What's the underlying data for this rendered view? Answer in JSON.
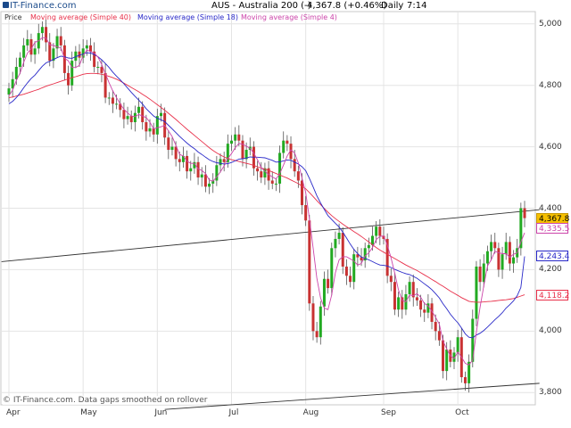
{
  "header": {
    "brand": "IT-Finance.com",
    "title": "AUS - Australia 200 (-)",
    "quote": "4,367.8 (+0.46%)",
    "interval": "Daily",
    "time": "7:14"
  },
  "legend": [
    {
      "label": "Price",
      "color": "#333333"
    },
    {
      "label": "Moving average (Simple 40)",
      "color": "#e8304a"
    },
    {
      "label": "Moving average (Simple 18)",
      "color": "#2828c8"
    },
    {
      "label": "Moving average (Simple 4)",
      "color": "#cc44aa"
    }
  ],
  "footer": "© IT-Finance.com. Data gaps smoothed on rollover",
  "badges": [
    {
      "text": "4,367.8",
      "value": 4367.8,
      "bg": "#f5c000",
      "fg": "#000000",
      "border": "#c89800"
    },
    {
      "text": "4,335.5",
      "value": 4335.5,
      "bg": "#ffffff",
      "fg": "#cc44aa",
      "border": "#cc44aa"
    },
    {
      "text": "4,243.4",
      "value": 4243.4,
      "bg": "#ffffff",
      "fg": "#2828c8",
      "border": "#2828c8"
    },
    {
      "text": "4,118.2",
      "value": 4118.2,
      "bg": "#ffffff",
      "fg": "#e8304a",
      "border": "#e8304a"
    }
  ],
  "colors": {
    "up": "#22aa22",
    "down": "#c83232",
    "wick": "#555555",
    "grid": "#e4e4e4",
    "trend": "#333333"
  },
  "chart_data": {
    "type": "candlestick",
    "title": "AUS - Australia 200 (-)",
    "ylim": [
      3760,
      5040
    ],
    "yticks": [
      3800,
      4000,
      4200,
      4400,
      4600,
      4800,
      5000
    ],
    "ytick_labels": [
      "3,800",
      "4,000",
      "4,200",
      "4,400",
      "4,600",
      "4,800",
      "5,000"
    ],
    "month_ticks": [
      {
        "label": "Apr",
        "day": 0
      },
      {
        "label": "May",
        "day": 20
      },
      {
        "label": "Jun",
        "day": 40
      },
      {
        "label": "Jul",
        "day": 60
      },
      {
        "label": "Aug",
        "day": 80
      },
      {
        "label": "Sep",
        "day": 101
      },
      {
        "label": "Oct",
        "day": 121
      }
    ],
    "n_days": 140,
    "closes": [
      4790,
      4820,
      4860,
      4890,
      4930,
      4950,
      4900,
      4920,
      4970,
      4990,
      4940,
      4880,
      4920,
      4960,
      4930,
      4840,
      4800,
      4880,
      4910,
      4890,
      4920,
      4930,
      4910,
      4860,
      4860,
      4840,
      4760,
      4760,
      4740,
      4740,
      4720,
      4690,
      4700,
      4680,
      4710,
      4730,
      4680,
      4650,
      4660,
      4640,
      4700,
      4710,
      4630,
      4590,
      4600,
      4560,
      4550,
      4570,
      4520,
      4530,
      4550,
      4500,
      4510,
      4470,
      4480,
      4490,
      4540,
      4560,
      4550,
      4610,
      4620,
      4640,
      4620,
      4560,
      4590,
      4600,
      4530,
      4520,
      4500,
      4530,
      4490,
      4480,
      4480,
      4580,
      4620,
      4610,
      4560,
      4520,
      4490,
      4410,
      4360,
      4090,
      4000,
      3980,
      4080,
      4170,
      4140,
      4270,
      4300,
      4320,
      4210,
      4180,
      4160,
      4250,
      4240,
      4230,
      4270,
      4280,
      4310,
      4340,
      4310,
      4300,
      4180,
      4160,
      4070,
      4110,
      4070,
      4120,
      4160,
      4110,
      4100,
      4070,
      4060,
      4090,
      4030,
      4000,
      3970,
      3870,
      3940,
      3900,
      3930,
      3980,
      3850,
      3830,
      3900,
      4040,
      4210,
      4160,
      4220,
      4260,
      4290,
      4270,
      4200,
      4250,
      4290,
      4220,
      4240,
      4270,
      4400,
      4367.8
    ],
    "ma4": [
      4766,
      4785,
      4816,
      4840,
      4875,
      4905,
      4918,
      4940,
      4945,
      4955,
      4955,
      4932,
      4930,
      4925,
      4922,
      4888,
      4880,
      4858,
      4858,
      4865,
      4897,
      4915,
      4910,
      4905,
      4892,
      4868,
      4838,
      4808,
      4782,
      4760,
      4740,
      4722,
      4710,
      4700,
      4698,
      4705,
      4700,
      4695,
      4680,
      4658,
      4662,
      4665,
      4670,
      4652,
      4633,
      4605,
      4575,
      4570,
      4553,
      4546,
      4546,
      4528,
      4523,
      4513,
      4492,
      4488,
      4502,
      4518,
      4538,
      4561,
      4578,
      4597,
      4611,
      4608,
      4602,
      4595,
      4579,
      4558,
      4532,
      4520,
      4510,
      4502,
      4495,
      4513,
      4540,
      4570,
      4590,
      4580,
      4548,
      4498,
      4450,
      4366,
      4270,
      4173,
      4108,
      4075,
      4070,
      4118,
      4190,
      4232,
      4242,
      4242,
      4235,
      4228,
      4215,
      4220,
      4245,
      4255,
      4272,
      4298,
      4308,
      4310,
      4280,
      4238,
      4188,
      4134,
      4100,
      4095,
      4118,
      4115,
      4122,
      4110,
      4090,
      4082,
      4065,
      4045,
      4023,
      3968,
      3942,
      3920,
      3910,
      3932,
      3915,
      3895,
      3890,
      3905,
      3996,
      4078,
      4148,
      4212,
      4232,
      4260,
      4255,
      4252,
      4252,
      4240,
      4250,
      4255,
      4290,
      4320
    ],
    "ma18": [
      4740,
      4748,
      4760,
      4775,
      4792,
      4808,
      4822,
      4833,
      4848,
      4862,
      4873,
      4878,
      4884,
      4890,
      4895,
      4893,
      4889,
      4888,
      4893,
      4898,
      4902,
      4906,
      4905,
      4900,
      4893,
      4883,
      4871,
      4858,
      4843,
      4830,
      4818,
      4805,
      4791,
      4777,
      4764,
      4752,
      4739,
      4724,
      4712,
      4700,
      4693,
      4688,
      4682,
      4670,
      4658,
      4646,
      4634,
      4623,
      4612,
      4602,
      4594,
      4583,
      4575,
      4566,
      4558,
      4552,
      4548,
      4546,
      4544,
      4545,
      4549,
      4554,
      4560,
      4561,
      4563,
      4567,
      4566,
      4566,
      4565,
      4564,
      4560,
      4556,
      4550,
      4551,
      4554,
      4557,
      4556,
      4550,
      4544,
      4535,
      4522,
      4497,
      4469,
      4441,
      4417,
      4396,
      4376,
      4363,
      4351,
      4339,
      4322,
      4303,
      4283,
      4266,
      4252,
      4241,
      4237,
      4232,
      4226,
      4220,
      4215,
      4214,
      4212,
      4207,
      4201,
      4196,
      4191,
      4187,
      4184,
      4178,
      4172,
      4163,
      4154,
      4145,
      4135,
      4122,
      4108,
      4089,
      4073,
      4055,
      4040,
      4027,
      4010,
      3991,
      3980,
      3978,
      3987,
      3993,
      4002,
      4013,
      4025,
      4037,
      4048,
      4060,
      4075,
      4086,
      4098,
      4115,
      4142,
      4243.4
    ],
    "ma40": [
      4760,
      4762,
      4765,
      4768,
      4771,
      4775,
      4779,
      4783,
      4787,
      4792,
      4797,
      4801,
      4805,
      4809,
      4813,
      4817,
      4821,
      4825,
      4828,
      4832,
      4836,
      4838,
      4839,
      4839,
      4838,
      4836,
      4833,
      4829,
      4825,
      4820,
      4814,
      4807,
      4800,
      4793,
      4786,
      4779,
      4771,
      4763,
      4755,
      4746,
      4737,
      4728,
      4719,
      4709,
      4699,
      4689,
      4678,
      4668,
      4657,
      4647,
      4637,
      4627,
      4617,
      4607,
      4597,
      4588,
      4580,
      4573,
      4567,
      4562,
      4558,
      4555,
      4552,
      4549,
      4546,
      4543,
      4539,
      4535,
      4531,
      4527,
      4523,
      4518,
      4513,
      4508,
      4503,
      4498,
      4492,
      4486,
      4480,
      4472,
      4463,
      4451,
      4438,
      4425,
      4412,
      4399,
      4387,
      4376,
      4366,
      4357,
      4348,
      4340,
      4332,
      4324,
      4316,
      4308,
      4299,
      4290,
      4281,
      4272,
      4264,
      4257,
      4250,
      4243,
      4236,
      4229,
      4222,
      4215,
      4209,
      4203,
      4197,
      4190,
      4183,
      4176,
      4168,
      4161,
      4153,
      4146,
      4138,
      4130,
      4123,
      4116,
      4109,
      4103,
      4097,
      4095,
      4094,
      4094,
      4095,
      4096,
      4097,
      4098,
      4100,
      4101,
      4102,
      4104,
      4106,
      4110,
      4114,
      4118.2
    ],
    "channel": [
      {
        "name": "upper",
        "from": {
          "day": -2,
          "value": 4226
        },
        "to": {
          "day": 143,
          "value": 4395
        }
      },
      {
        "name": "lower",
        "from": {
          "day": 42,
          "value": 3745
        },
        "to": {
          "day": 143,
          "value": 3830
        }
      }
    ]
  }
}
